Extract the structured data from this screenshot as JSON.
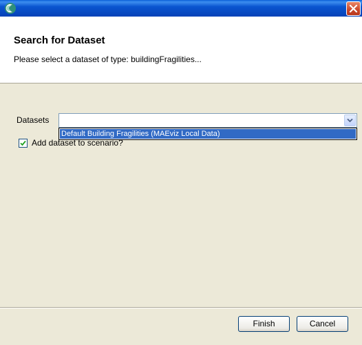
{
  "window": {
    "colors": {
      "titlebar": "#0a55d0",
      "selection": "#316ac5",
      "dialog_bg": "#ece9d8"
    }
  },
  "header": {
    "title": "Search for Dataset",
    "description": "Please select a dataset of type: buildingFragilities..."
  },
  "form": {
    "datasets_label": "Datasets",
    "datasets_value": "",
    "dropdown_options": [
      "Default Building Fragilities   (MAEviz Local Data)"
    ],
    "add_to_scenario_label": "Add dataset to scenario?",
    "add_to_scenario_checked": true
  },
  "footer": {
    "finish_label": "Finish",
    "cancel_label": "Cancel"
  }
}
